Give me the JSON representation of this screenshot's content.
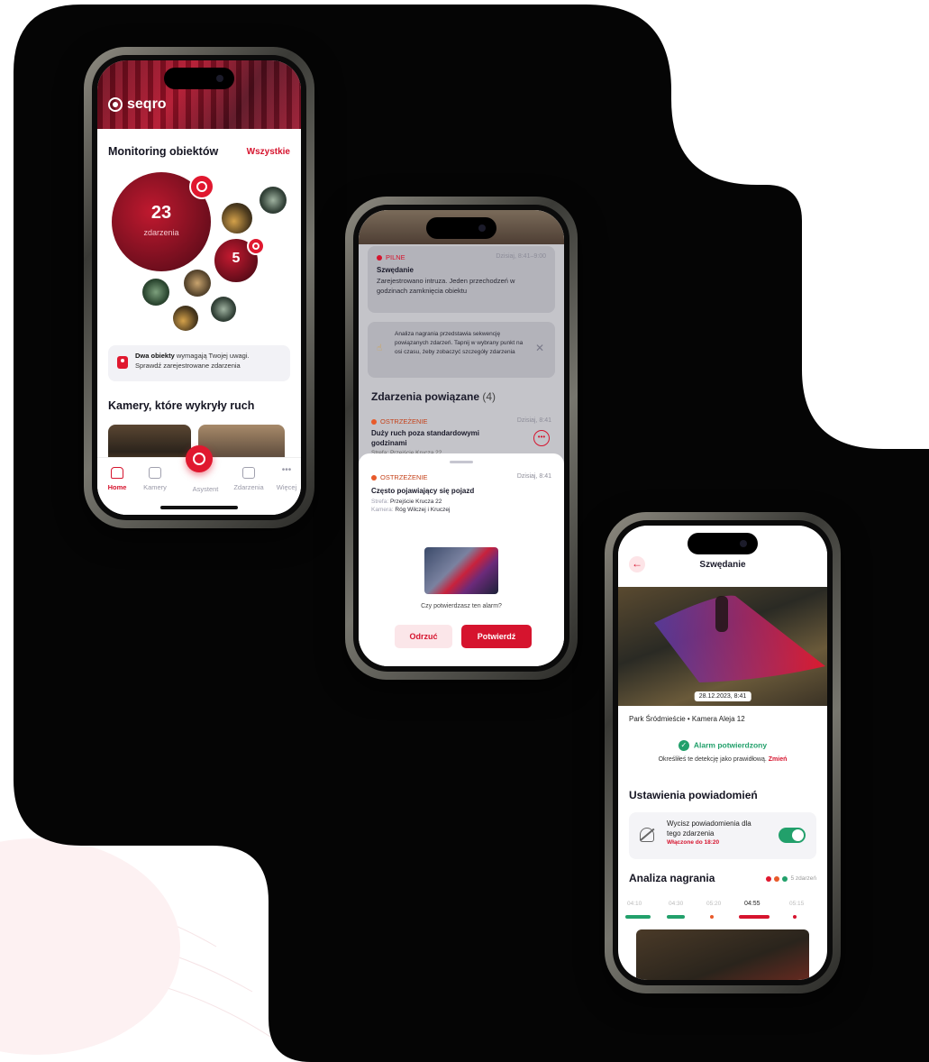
{
  "phone1": {
    "brand": "seqro",
    "section1": {
      "title": "Monitoring obiektów",
      "link": "Wszystkie"
    },
    "bubble_main": {
      "count": "23",
      "label": "zdarzenia"
    },
    "bubble_small": {
      "count": "5"
    },
    "alert": {
      "bold": "Dwa obiekty",
      "rest": " wymagają Twojej uwagi.",
      "line2": "Sprawdź zarejestrowane zdarzenia"
    },
    "section2": {
      "title": "Kamery, które wykryły ruch"
    },
    "tabs": [
      {
        "label": "Home"
      },
      {
        "label": "Kamery"
      },
      {
        "label": "Asystent"
      },
      {
        "label": "Zdarzenia"
      },
      {
        "label": "Więcej"
      }
    ]
  },
  "phone2": {
    "event1": {
      "tag": "PILNE",
      "time": "Dzisiaj, 8:41–9:00",
      "title": "Szwędanie",
      "text": "Zarejestrowano intruza. Jeden przechodzeń w godzinach zamknięcia obiektu"
    },
    "hint": {
      "text": "Analiza nagrania przedstawia sekwencję powiązanych zdarzeń. Tapnij w wybrany punkt na osi czasu, żeby zobaczyć szczegóły zdarzenia"
    },
    "related": {
      "title": "Zdarzenia powiązane",
      "count": "(4)"
    },
    "event2": {
      "tag": "OSTRZEŻENIE",
      "time": "Dzisiaj, 8:41",
      "title": "Duży ruch poza standardowymi godzinami",
      "zone": "Strefa: Przejście Krucza 22"
    },
    "sheet": {
      "tag": "OSTRZEŻENIE",
      "time": "Dzisiaj, 8:41",
      "title": "Często pojawiający się pojazd",
      "zone_label": "Strefa:",
      "zone_value": "Przejście Krucza 22",
      "camera_label": "Kamera:",
      "camera_value": "Róg Wilczej i Kruczej",
      "question": "Czy potwierdzasz ten alarm?",
      "reject": "Odrzuć",
      "confirm": "Potwierdź"
    }
  },
  "phone3": {
    "nav_title": "Szwędanie",
    "timestamp": "28.12.2023, 8:41",
    "location": "Park Śródmieście • Kamera Aleja 12",
    "confirmed": "Alarm potwierdzony",
    "confirmed_sub": "Określiłeś te detekcję jako prawidłową.",
    "change": "Zmień",
    "notif_title": "Ustawienia powiadomień",
    "notif_text": "Wycisz powiadomienia dla tego zdarzenia",
    "notif_until": "Włączone do 18:20",
    "analysis_title": "Analiza nagrania",
    "analysis_count": "5 zdarzeń",
    "timeline": [
      "04:10",
      "04:30",
      "05:20",
      "04:55",
      "05:15"
    ]
  },
  "colors": {
    "accent": "#d6142e",
    "success": "#22a06b",
    "warning": "#e85a2a"
  }
}
